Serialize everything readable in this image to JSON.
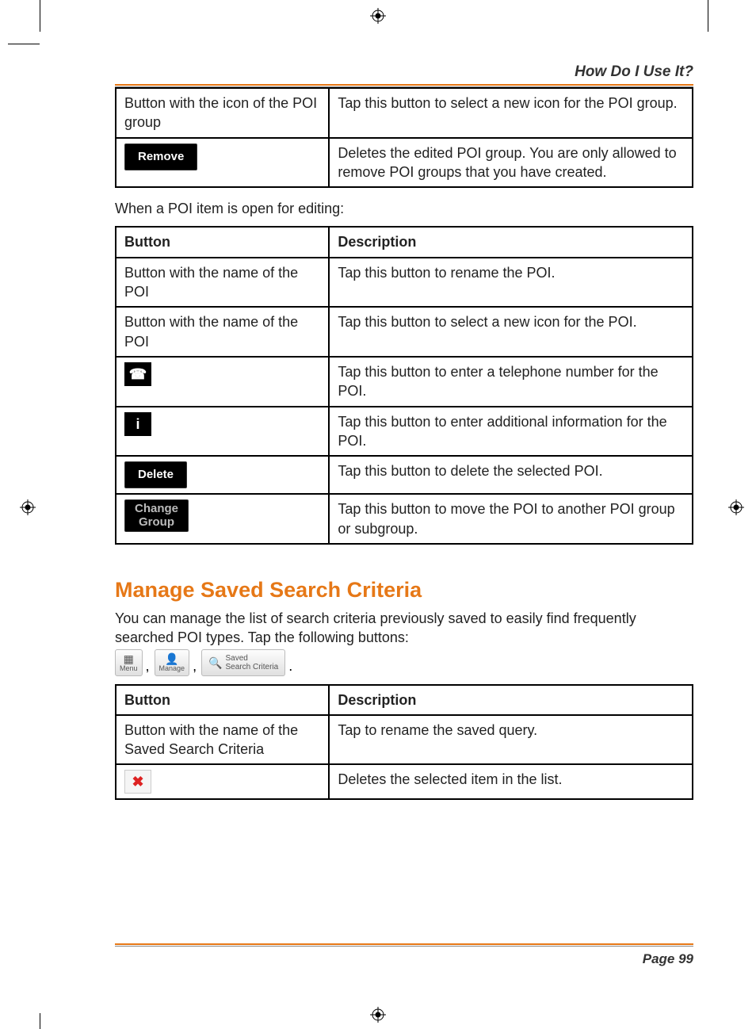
{
  "header": {
    "title": "How Do I Use It?"
  },
  "table1": {
    "rows": [
      {
        "button_text": "Button with the icon of the POI group",
        "description": "Tap this button to select a new icon for the POI group."
      },
      {
        "button_label": "Remove",
        "description": "Deletes the edited POI group. You are only allowed to remove POI groups that you have created."
      }
    ]
  },
  "paragraph1": "When a POI item is open for editing:",
  "table2": {
    "header": {
      "col1": "Button",
      "col2": "Description"
    },
    "rows": [
      {
        "button_text": "Button with the name of the POI",
        "description": "Tap this button to rename the POI."
      },
      {
        "button_text": "Button with the name of the POI",
        "description": "Tap this button to select a new icon for the POI."
      },
      {
        "icon": "phone",
        "description": "Tap this button to enter a telephone number for the POI."
      },
      {
        "icon": "info",
        "description": "Tap this button to enter additional information for the POI."
      },
      {
        "button_label": "Delete",
        "description": "Tap this button to delete the selected POI."
      },
      {
        "button_label_line1": "Change",
        "button_label_line2": "Group",
        "description": "Tap this button to move the POI to another POI group or subgroup."
      }
    ]
  },
  "section": {
    "heading": "Manage Saved Search Criteria",
    "paragraph": "You can manage the list of search criteria previously saved to easily find frequently searched POI types. Tap the following buttons:",
    "inline_buttons": [
      {
        "icon": "menu",
        "label": "Menu"
      },
      {
        "icon": "manage",
        "label": "Manage"
      },
      {
        "icon": "search",
        "label_line1": "Saved",
        "label_line2": "Search Criteria"
      }
    ]
  },
  "table3": {
    "header": {
      "col1": "Button",
      "col2": "Description"
    },
    "rows": [
      {
        "button_text": "Button with the name of the Saved Search Criteria",
        "description": "Tap to rename the saved query."
      },
      {
        "icon": "delete-x",
        "description": "Deletes the selected item in the list."
      }
    ]
  },
  "footer": {
    "page_label": "Page 99"
  }
}
